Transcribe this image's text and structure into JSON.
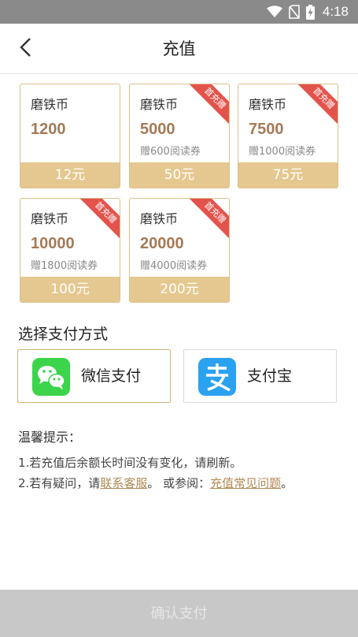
{
  "status_bar": {
    "time": "4:18",
    "icons": [
      "wifi-icon",
      "no-sim-icon",
      "battery-charging-icon"
    ]
  },
  "header": {
    "back_icon": "chevron-left-icon",
    "title": "充值"
  },
  "cards": [
    {
      "name": "磨铁币",
      "amount": "1200",
      "bonus": "",
      "price": "12元",
      "ribbon": ""
    },
    {
      "name": "磨铁币",
      "amount": "5000",
      "bonus": "赠600阅读券",
      "price": "50元",
      "ribbon": "首充赠"
    },
    {
      "name": "磨铁币",
      "amount": "7500",
      "bonus": "赠1000阅读券",
      "price": "75元",
      "ribbon": "首充赠"
    },
    {
      "name": "磨铁币",
      "amount": "10000",
      "bonus": "赠1800阅读券",
      "price": "100元",
      "ribbon": "首充赠"
    },
    {
      "name": "磨铁币",
      "amount": "20000",
      "bonus": "赠4000阅读券",
      "price": "200元",
      "ribbon": "首充赠"
    }
  ],
  "payment": {
    "title": "选择支付方式",
    "options": [
      {
        "label": "微信支付",
        "icon": "wechat-icon",
        "selected": true
      },
      {
        "label": "支付宝",
        "icon": "alipay-icon",
        "selected": false
      }
    ]
  },
  "tips": {
    "title": "温馨提示：",
    "line1": "1.若充值后余额长时间没有变化，请刷新。",
    "line2_prefix": "2.若有疑问，请",
    "line2_link1": "联系客服",
    "line2_middle": "。 或参阅：",
    "line2_link2": "充值常见问题",
    "line2_suffix": "。"
  },
  "confirm_button": "确认支付",
  "colors": {
    "accent_gold": "#e5c890",
    "amount_brown": "#a57a55",
    "ribbon_red": "#e4534b",
    "status_bar": "#8a8a8a",
    "disabled_button": "#c8c8c8",
    "wechat_green": "#3bd44a",
    "alipay_blue": "#2aa2f0"
  }
}
